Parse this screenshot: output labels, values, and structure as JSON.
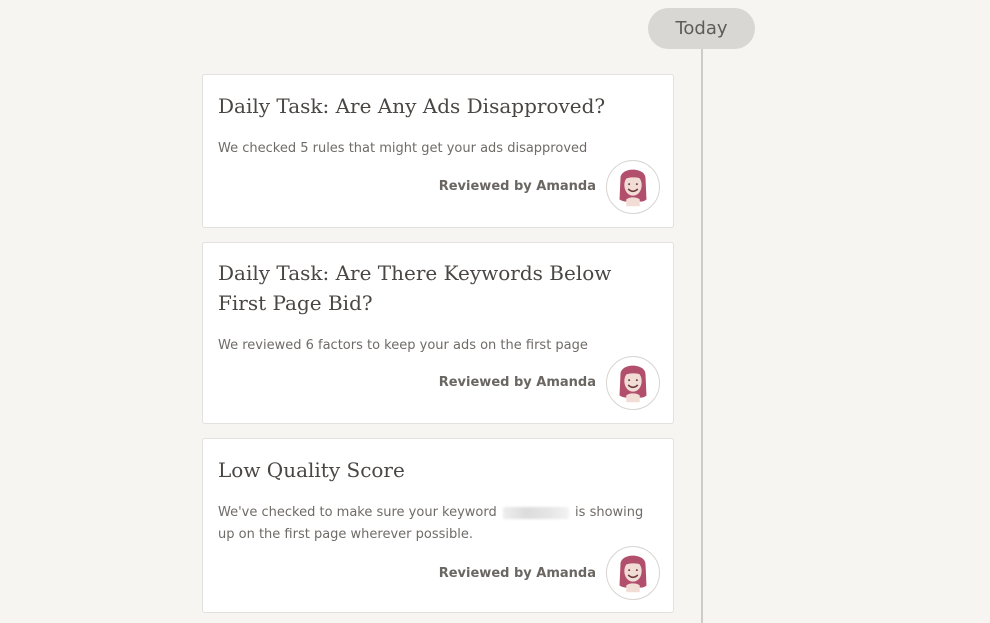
{
  "timeline": {
    "today_label": "Today"
  },
  "cards": [
    {
      "title": "Daily Task: Are Any Ads Disapproved?",
      "description": "We checked 5 rules that might get your ads disapproved",
      "reviewer_label": "Reviewed by Amanda",
      "avatar_icon": "amanda-avatar-icon"
    },
    {
      "title": "Daily Task: Are There Keywords Below First Page Bid?",
      "description": "We reviewed 6 factors to keep your ads on the first page",
      "reviewer_label": "Reviewed by Amanda",
      "avatar_icon": "amanda-avatar-icon"
    },
    {
      "title": "Low Quality Score",
      "description_before": "We've checked to make sure your keyword",
      "description_after": "is showing up on the first page wherever possible.",
      "reviewer_label": "Reviewed by Amanda",
      "avatar_icon": "amanda-avatar-icon"
    }
  ],
  "colors": {
    "background": "#f6f5f2",
    "card": "#ffffff",
    "avatar_hair": "#b24f6c",
    "timeline_line": "#cfccc8",
    "pill": "#d9d7d4"
  }
}
